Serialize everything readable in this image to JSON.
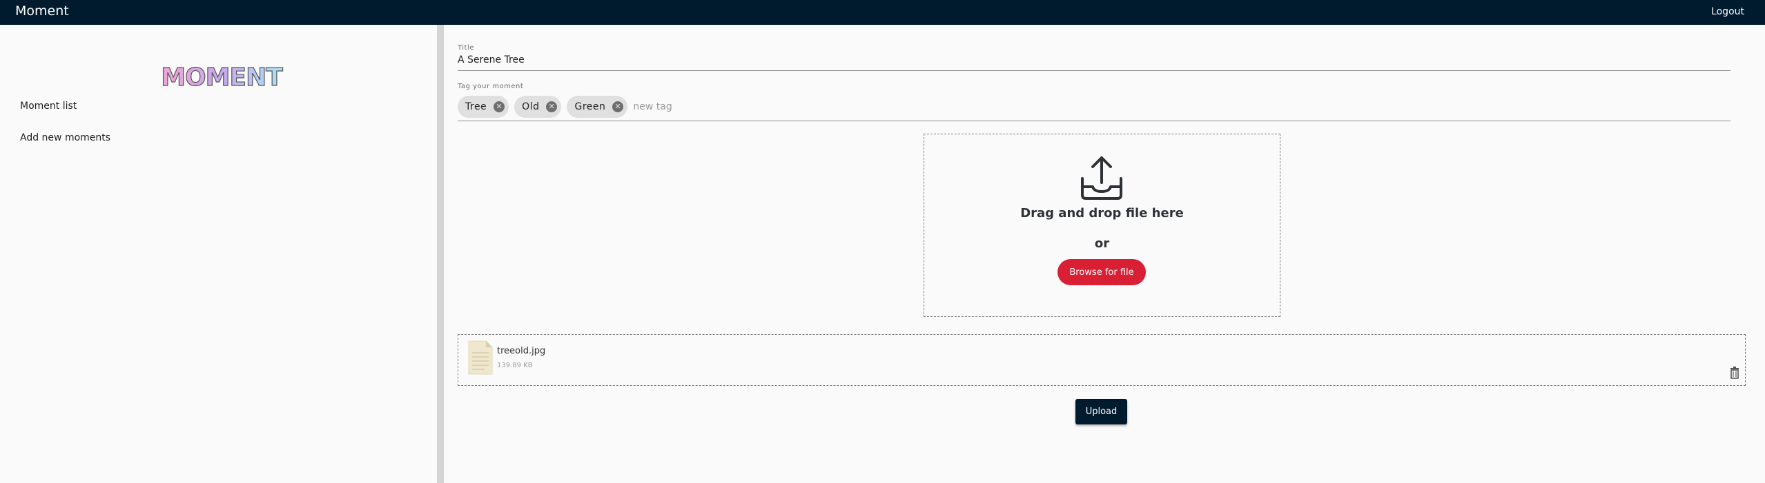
{
  "header": {
    "app_title": "Moment",
    "logout_label": "Logout"
  },
  "sidebar": {
    "logo_text": "MOMENT",
    "items": [
      {
        "label": "Moment list"
      },
      {
        "label": "Add new moments"
      }
    ]
  },
  "form": {
    "title_label": "Title",
    "title_value": "A Serene Tree",
    "tag_label": "Tag your moment",
    "tags": [
      {
        "label": "Tree"
      },
      {
        "label": "Old"
      },
      {
        "label": "Green"
      }
    ],
    "new_tag_placeholder": "new tag"
  },
  "dropzone": {
    "drag_text": "Drag and drop file here",
    "or_text": "or",
    "browse_label": "Browse for file"
  },
  "file": {
    "name": "treeold.jpg",
    "size": "139.89 KB"
  },
  "upload_label": "Upload",
  "colors": {
    "topbar": "#001a2e",
    "accent_red": "#d81f33",
    "chip_bg": "#e0e0e0"
  }
}
